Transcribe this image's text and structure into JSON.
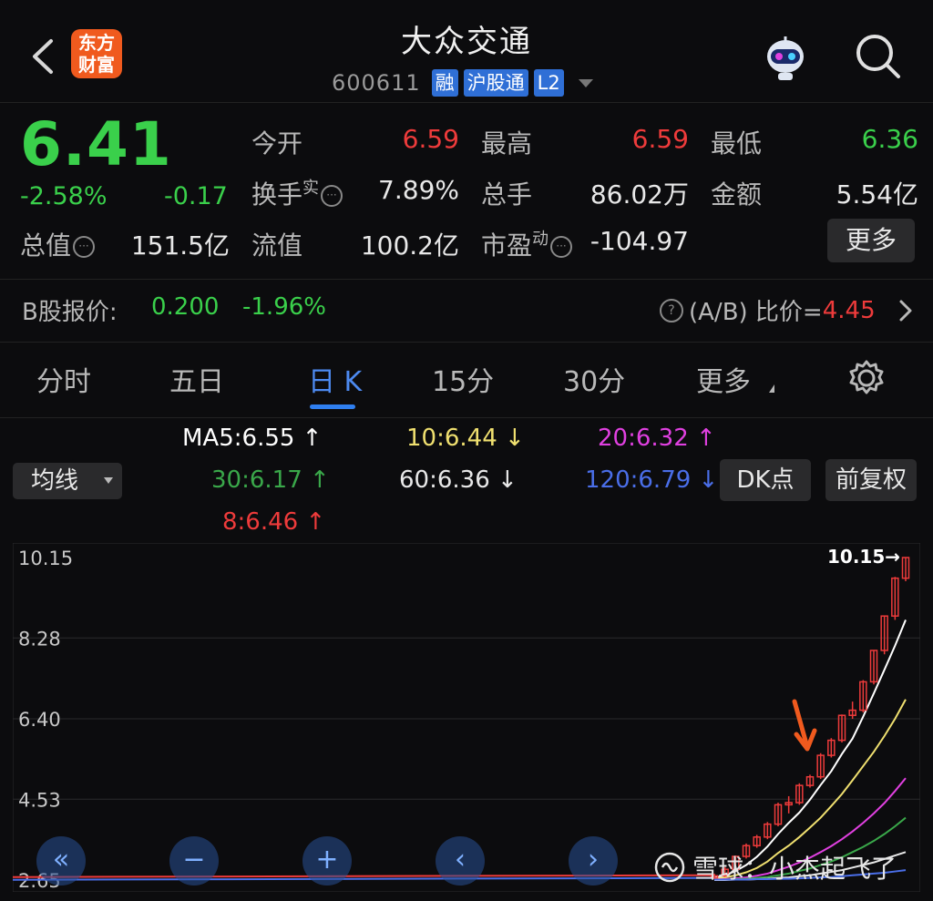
{
  "header": {
    "back": "back",
    "logo_line1": "东方",
    "logo_line2": "财富",
    "title": "大众交通",
    "code": "600611",
    "tags": [
      "融",
      "沪股通",
      "L2"
    ]
  },
  "quote": {
    "price": "6.41",
    "change_pct": "-2.58%",
    "change": "-0.17",
    "open_label": "今开",
    "open": "6.59",
    "high_label": "最高",
    "high": "6.59",
    "low_label": "最低",
    "low": "6.36",
    "turnover_label": "换手",
    "turnover_sup": "实",
    "turnover": "7.89%",
    "volume_label": "总手",
    "volume": "86.02万",
    "amount_label": "金额",
    "amount": "5.54亿",
    "mktcap_label": "总值",
    "mktcap": "151.5亿",
    "float_label": "流值",
    "float": "100.2亿",
    "pe_label": "市盈",
    "pe_sup": "动",
    "pe": "-104.97",
    "more_label": "更多"
  },
  "bshare": {
    "label": "B股报价:",
    "price": "0.200",
    "pct": "-1.96%",
    "ratio_label": "(A/B) 比价=",
    "ratio_value": "4.45"
  },
  "tabs": [
    "分时",
    "五日",
    "日 K",
    "15分",
    "30分",
    "更多"
  ],
  "ma": {
    "dropdown": "均线",
    "ma5": "MA5:6.55",
    "ma10": "10:6.44",
    "ma20": "20:6.32",
    "ma30": "30:6.17",
    "ma60": "60:6.36",
    "ma120": "120:6.79",
    "ma8": "8:6.46",
    "dk_label": "DK点",
    "fq_label": "前复权"
  },
  "colors": {
    "up": "#ee3b3b",
    "down": "#3ad04b",
    "accent": "#2f7ff0",
    "ma5": "#ffffff",
    "ma10": "#f0e070",
    "ma20": "#e040e0",
    "ma30": "#3aa84a",
    "ma60": "#e8e8e8",
    "ma120": "#4a6ee8",
    "ma8": "#ee3b3b"
  },
  "chart_data": {
    "type": "candlestick",
    "y_ticks": [
      "10.15",
      "8.28",
      "6.40",
      "4.53",
      "2.65"
    ],
    "ylim": [
      2.65,
      10.15
    ],
    "max_label": "10.15",
    "bottom_label": "2.65",
    "candles": [
      {
        "o": 2.7,
        "c": 2.75,
        "h": 2.8,
        "l": 2.68
      },
      {
        "o": 2.75,
        "c": 2.9,
        "h": 2.95,
        "l": 2.72
      },
      {
        "o": 2.9,
        "c": 3.2,
        "h": 3.22,
        "l": 2.88
      },
      {
        "o": 3.2,
        "c": 3.45,
        "h": 3.5,
        "l": 3.15
      },
      {
        "o": 3.45,
        "c": 3.65,
        "h": 3.7,
        "l": 3.4
      },
      {
        "o": 3.65,
        "c": 3.95,
        "h": 4.0,
        "l": 3.6
      },
      {
        "o": 3.95,
        "c": 4.4,
        "h": 4.45,
        "l": 3.9
      },
      {
        "o": 4.4,
        "c": 4.45,
        "h": 4.6,
        "l": 4.2
      },
      {
        "o": 4.45,
        "c": 4.85,
        "h": 4.9,
        "l": 4.4
      },
      {
        "o": 4.85,
        "c": 5.05,
        "h": 5.1,
        "l": 4.8
      },
      {
        "o": 5.05,
        "c": 5.55,
        "h": 5.6,
        "l": 5.0
      },
      {
        "o": 5.55,
        "c": 5.9,
        "h": 5.95,
        "l": 5.5
      },
      {
        "o": 5.9,
        "c": 6.48,
        "h": 6.5,
        "l": 5.85
      },
      {
        "o": 6.48,
        "c": 6.6,
        "h": 6.8,
        "l": 6.4
      },
      {
        "o": 6.6,
        "c": 7.26,
        "h": 7.3,
        "l": 6.55
      },
      {
        "o": 7.26,
        "c": 7.99,
        "h": 8.0,
        "l": 7.2
      },
      {
        "o": 7.99,
        "c": 8.79,
        "h": 8.8,
        "l": 7.9
      },
      {
        "o": 8.79,
        "c": 9.67,
        "h": 9.7,
        "l": 8.7
      },
      {
        "o": 9.67,
        "c": 10.15,
        "h": 10.15,
        "l": 9.6
      }
    ],
    "series": [
      {
        "name": "MA5",
        "values": [
          2.7,
          2.76,
          2.86,
          3.0,
          3.19,
          3.43,
          3.72,
          3.98,
          4.22,
          4.52,
          4.86,
          5.18,
          5.58,
          5.94,
          6.45,
          6.99,
          7.54,
          8.1,
          8.7
        ]
      },
      {
        "name": "MA10",
        "values": [
          2.68,
          2.71,
          2.76,
          2.83,
          2.93,
          3.08,
          3.28,
          3.45,
          3.65,
          3.87,
          4.1,
          4.37,
          4.65,
          4.97,
          5.3,
          5.63,
          6.0,
          6.4,
          6.85
        ]
      },
      {
        "name": "MA20",
        "values": [
          2.66,
          2.67,
          2.69,
          2.71,
          2.75,
          2.8,
          2.88,
          2.96,
          3.06,
          3.17,
          3.3,
          3.44,
          3.6,
          3.78,
          3.98,
          4.2,
          4.44,
          4.72,
          5.02
        ]
      },
      {
        "name": "MA30",
        "values": [
          2.65,
          2.66,
          2.67,
          2.68,
          2.7,
          2.72,
          2.76,
          2.8,
          2.86,
          2.92,
          3.0,
          3.08,
          3.18,
          3.3,
          3.42,
          3.56,
          3.72,
          3.9,
          4.1
        ]
      },
      {
        "name": "MA60",
        "values": [
          2.65,
          2.65,
          2.66,
          2.66,
          2.67,
          2.68,
          2.7,
          2.71,
          2.74,
          2.76,
          2.8,
          2.84,
          2.88,
          2.94,
          3.0,
          3.06,
          3.14,
          3.22,
          3.3
        ]
      },
      {
        "name": "MA120",
        "values": [
          2.66,
          2.66,
          2.66,
          2.66,
          2.67,
          2.67,
          2.68,
          2.68,
          2.69,
          2.7,
          2.71,
          2.72,
          2.74,
          2.76,
          2.78,
          2.8,
          2.82,
          2.85,
          2.88
        ]
      }
    ]
  },
  "nav_buttons": [
    "«",
    "−",
    "+",
    "‹",
    "›"
  ],
  "watermark": "雪球：小杰起飞了"
}
